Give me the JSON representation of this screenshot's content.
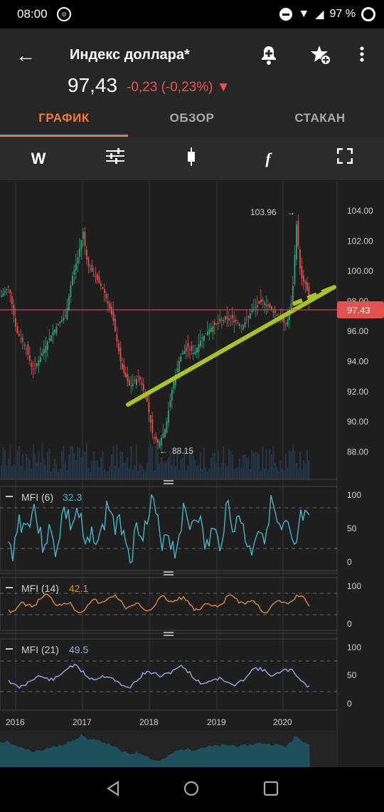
{
  "status": {
    "time": "08:00",
    "battery": "97 %"
  },
  "header": {
    "title": "Индекс доллара*",
    "price": "97,43",
    "change": "-0,23 (-0,23%) ▼"
  },
  "tabs": [
    {
      "label": "ГРАФИК",
      "active": true
    },
    {
      "label": "ОБЗОР",
      "active": false
    },
    {
      "label": "СТАКАН",
      "active": false
    }
  ],
  "toolbar": {
    "interval": "W",
    "fx": "f"
  },
  "chart": {
    "price_axis": [
      "104.00",
      "102.00",
      "100.00",
      "98.00",
      "96.00",
      "94.00",
      "92.00",
      "90.00",
      "88.00"
    ],
    "current_price_label": "97.43",
    "high_label": "103.96",
    "low_label": "88.15",
    "years": [
      "2016",
      "2017",
      "2018",
      "2019",
      "2020"
    ],
    "colors": {
      "up": "#3aa07a",
      "down": "#e45151",
      "trendline": "#a7c22a",
      "price_line": "#e45151"
    }
  },
  "indicators": [
    {
      "name": "MFI (6)",
      "value": "32.3",
      "color": "#4bb3c8",
      "axis": [
        "100",
        "50",
        "0"
      ]
    },
    {
      "name": "MFI (14)",
      "value": "42.1",
      "color": "#e0873a",
      "axis": [
        "100",
        "0"
      ]
    },
    {
      "name": "MFI (21)",
      "value": "49.5",
      "color": "#9aa7e6",
      "axis": [
        "100",
        "50",
        "0"
      ]
    }
  ]
}
